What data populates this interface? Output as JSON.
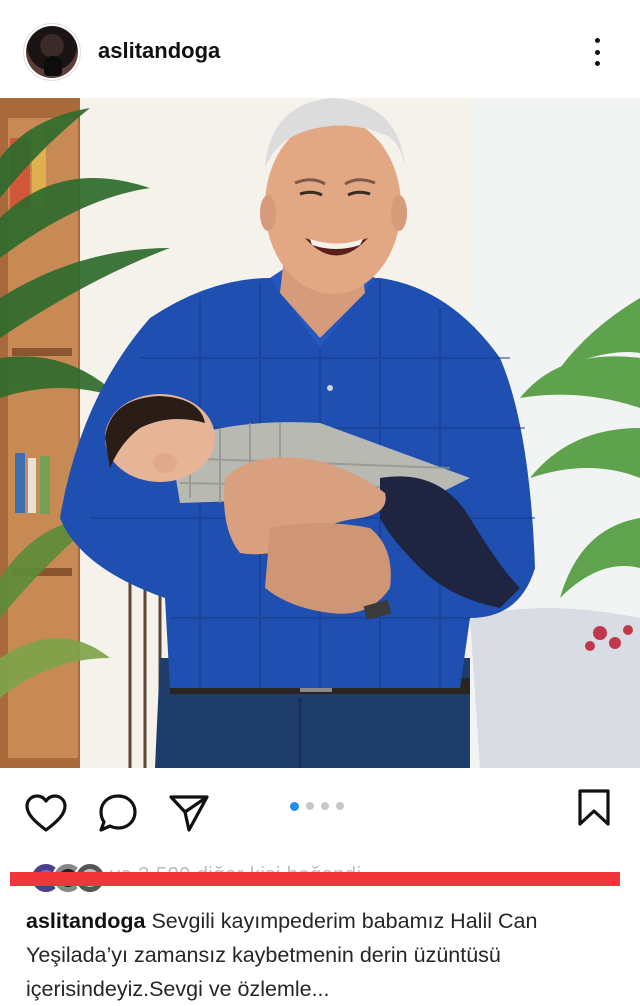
{
  "post": {
    "username": "aslitandoga",
    "caption_user": "aslitandoga",
    "caption_text": "Sevgili kayımpederim babamız Halil Can Yeşilada’yı zamansız kaybetmenin derin üzüntüsü içerisindeyiz.Sevgi ve özlemle...",
    "likes_text": "ve 3.500 diğer kişi beğendi",
    "carousel": {
      "count": 4,
      "active_index": 0
    }
  },
  "icons": {
    "more": "more-vertical-icon",
    "like": "heart-icon",
    "comment": "comment-icon",
    "share": "send-icon",
    "save": "bookmark-icon"
  },
  "colors": {
    "accent_blue": "#1f8ef1",
    "redaction": "#f0353b"
  }
}
